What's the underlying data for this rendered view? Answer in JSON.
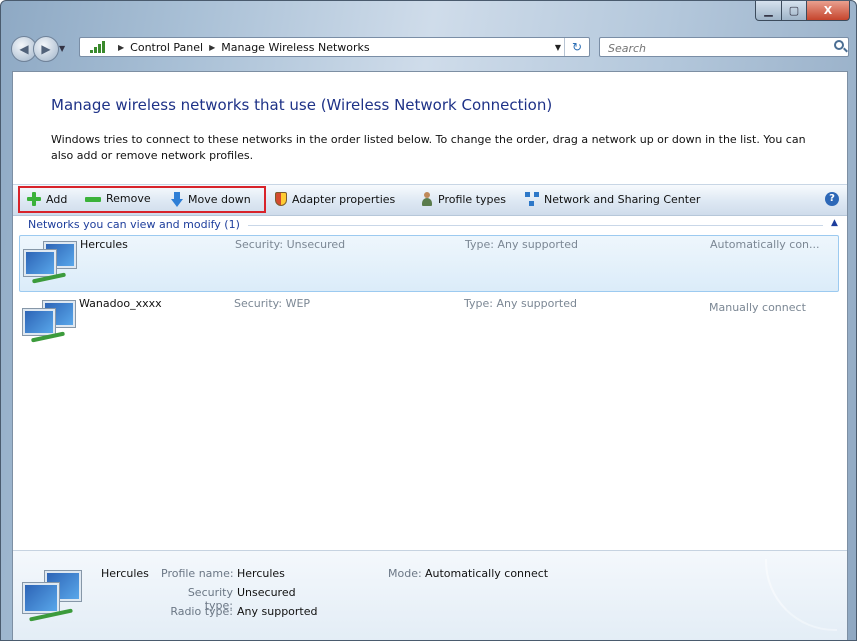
{
  "window": {
    "caption": {
      "minimize_glyph": "▁",
      "maximize_glyph": "▢",
      "close_glyph": "X"
    }
  },
  "nav": {
    "breadcrumb": [
      "Control Panel",
      "Manage Wireless Networks"
    ],
    "search_placeholder": "Search"
  },
  "page": {
    "title": "Manage wireless networks that use (Wireless Network Connection)",
    "description": "Windows tries to connect to these networks in the order listed below. To change the order, drag a network up or down in the list. You can also add or remove network profiles."
  },
  "toolbar": {
    "add": "Add",
    "remove": "Remove",
    "move_down": "Move down",
    "adapter_properties": "Adapter properties",
    "profile_types": "Profile types",
    "network_sharing": "Network and Sharing Center",
    "help": "?"
  },
  "group": {
    "header": "Networks you can view and modify (1)"
  },
  "networks": [
    {
      "name": "Hercules",
      "security": "Security: Unsecured",
      "type": "Type: Any supported",
      "mode": "Automatically con..."
    },
    {
      "name": "Wanadoo_xxxx",
      "security": "Security: WEP",
      "type": "Type: Any supported",
      "mode": "Manually connect"
    }
  ],
  "details": {
    "name": "Hercules",
    "profile_label": "Profile name:",
    "profile_value": "Hercules",
    "security_label": "Security type:",
    "security_value": "Unsecured",
    "radio_label": "Radio type:",
    "radio_value": "Any supported",
    "mode_label": "Mode:",
    "mode_value": "Automatically connect"
  }
}
